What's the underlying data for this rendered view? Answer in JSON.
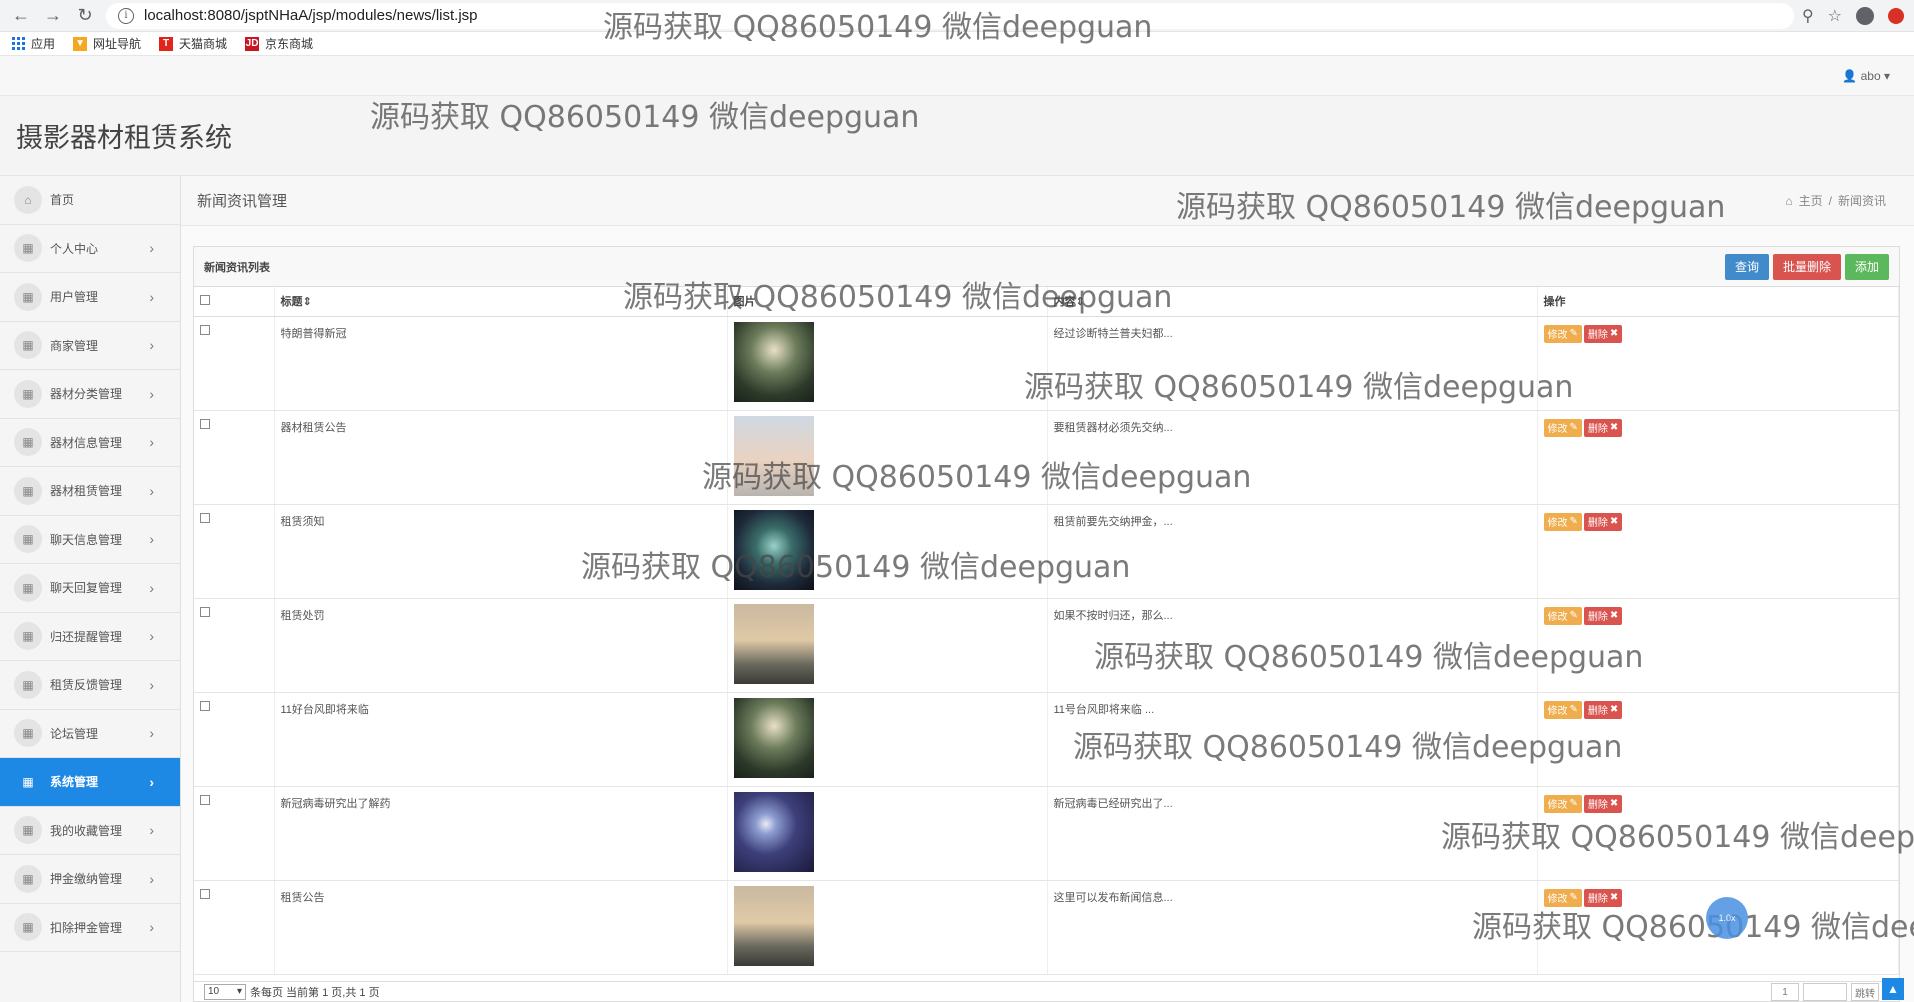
{
  "browser": {
    "url": "localhost:8080/jsptNHaA/jsp/modules/news/list.jsp",
    "bookmarks": [
      "应用",
      "网址导航",
      "天猫商城",
      "京东商城"
    ]
  },
  "user": {
    "name": "abo"
  },
  "app": {
    "title": "摄影器材租赁系统"
  },
  "sidebar": {
    "items": [
      {
        "label": "首页",
        "icon": "home-icon"
      },
      {
        "label": "个人中心",
        "icon": "grid-icon"
      },
      {
        "label": "用户管理",
        "icon": "grid-icon"
      },
      {
        "label": "商家管理",
        "icon": "grid-icon"
      },
      {
        "label": "器材分类管理",
        "icon": "grid-icon"
      },
      {
        "label": "器材信息管理",
        "icon": "grid-icon"
      },
      {
        "label": "器材租赁管理",
        "icon": "grid-icon"
      },
      {
        "label": "聊天信息管理",
        "icon": "grid-icon"
      },
      {
        "label": "聊天回复管理",
        "icon": "grid-icon"
      },
      {
        "label": "归还提醒管理",
        "icon": "grid-icon"
      },
      {
        "label": "租赁反馈管理",
        "icon": "grid-icon"
      },
      {
        "label": "论坛管理",
        "icon": "grid-icon"
      },
      {
        "label": "系统管理",
        "icon": "grid-icon"
      },
      {
        "label": "我的收藏管理",
        "icon": "grid-icon"
      },
      {
        "label": "押金缴纳管理",
        "icon": "grid-icon"
      },
      {
        "label": "扣除押金管理",
        "icon": "grid-icon"
      }
    ]
  },
  "page": {
    "title": "新闻资讯管理",
    "breadcrumb": {
      "home": "主页",
      "sep": "/",
      "current": "新闻资讯"
    }
  },
  "panel": {
    "title": "新闻资讯列表",
    "buttons": {
      "query": "查询",
      "batch_delete": "批量删除",
      "add": "添加"
    }
  },
  "table": {
    "headers": {
      "title": "标题",
      "image": "图片",
      "content": "内容",
      "action": "操作"
    },
    "rows": [
      {
        "title": "特朗普得新冠",
        "content": "经过诊断特兰普夫妇都..."
      },
      {
        "title": "器材租赁公告",
        "content": "要租赁器材必须先交纳..."
      },
      {
        "title": "租赁须知",
        "content": "租赁前要先交纳押金，..."
      },
      {
        "title": "租赁处罚",
        "content": "如果不按时归还，那么..."
      },
      {
        "title": "11好台风即将来临",
        "content": "11号台风即将来临 ..."
      },
      {
        "title": "新冠病毒研究出了解药",
        "content": "新冠病毒已经研究出了..."
      },
      {
        "title": "租赁公告",
        "content": "这里可以发布新闻信息..."
      }
    ],
    "edit_label": "修改",
    "delete_label": "删除"
  },
  "footer": {
    "page_size": "10",
    "info": "条每页 当前第 1 页,共 1 页",
    "page_num": "1",
    "jump_label": "跳转"
  },
  "watermark": "源码获取 QQ86050149 微信deepguan",
  "float_ball": "1.0x",
  "colors": {
    "primary": "#1e88e5",
    "query": "#428bca",
    "danger": "#d9534f",
    "add": "#5cb85c",
    "edit": "#f0ad4e"
  }
}
